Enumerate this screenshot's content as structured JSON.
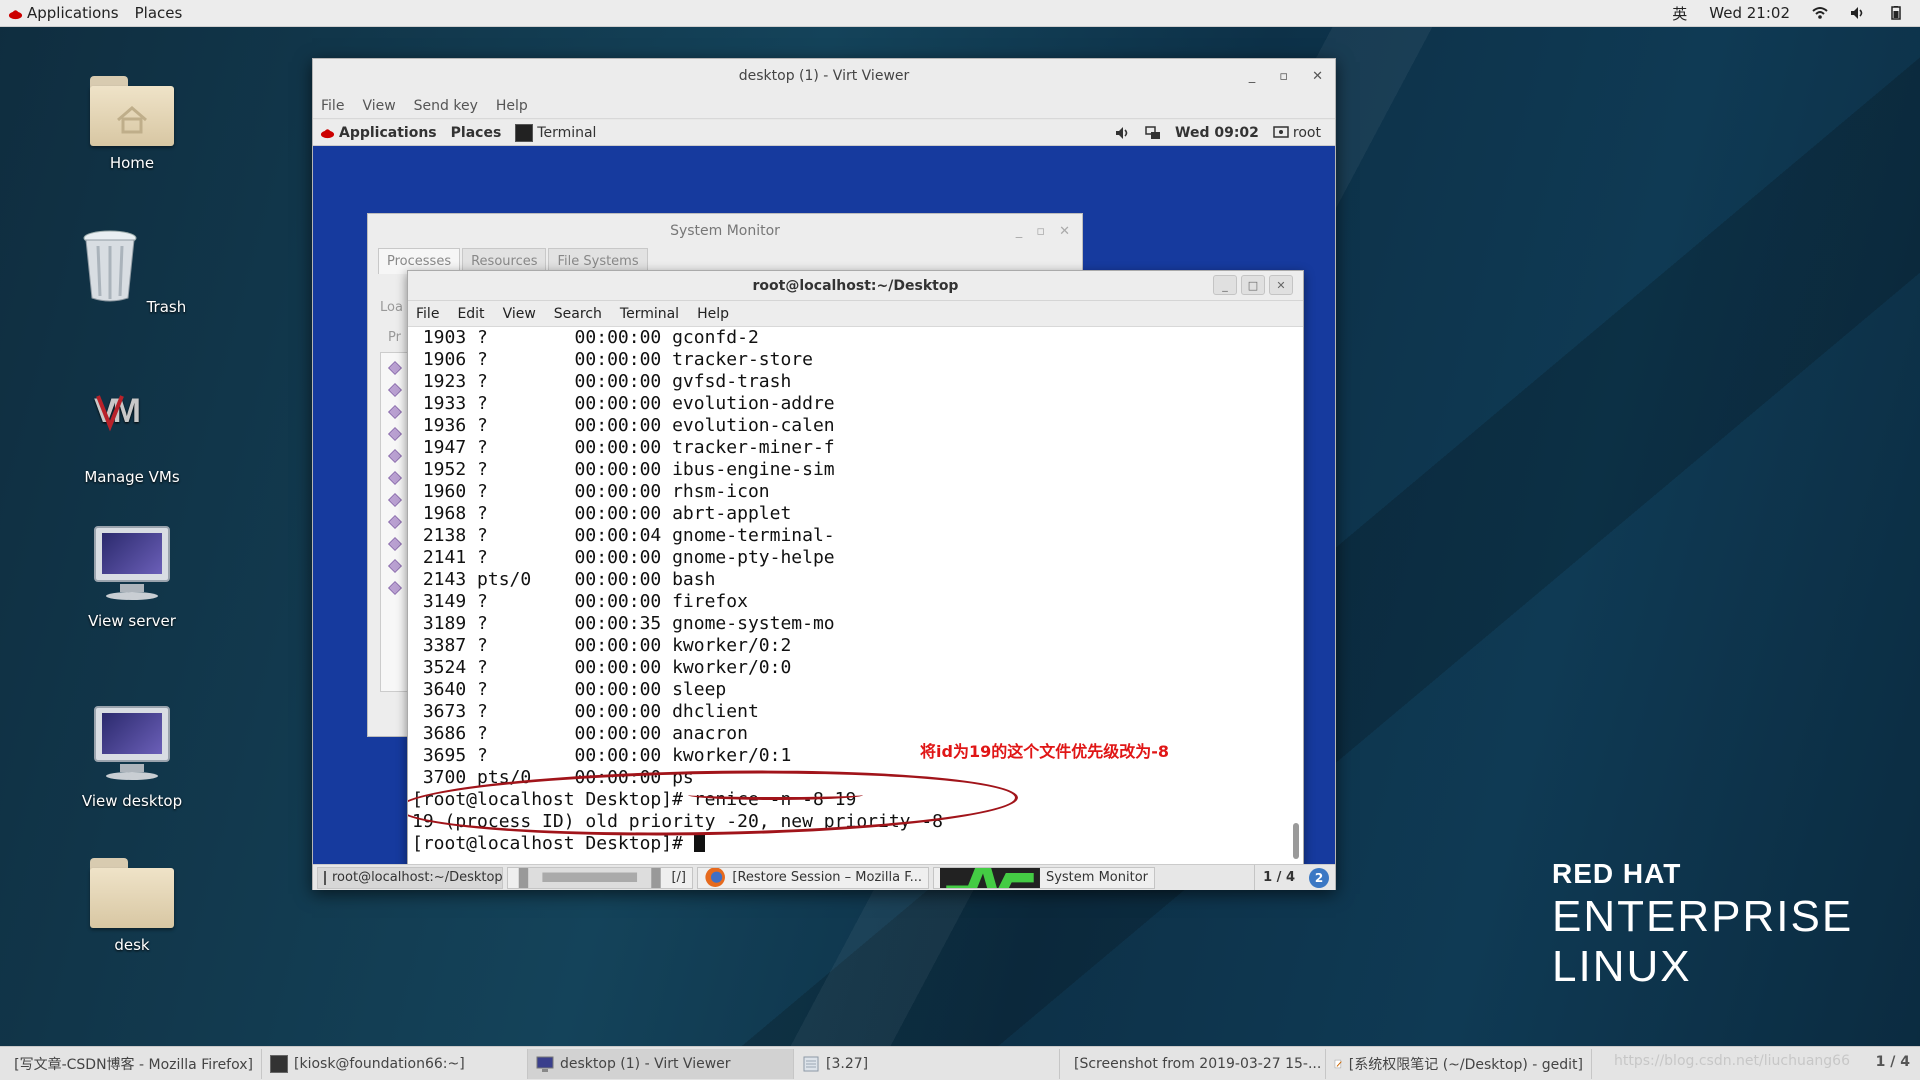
{
  "host_topbar": {
    "applications": "Applications",
    "places": "Places",
    "input_method": "英",
    "clock": "Wed 21:02"
  },
  "desktop_icons": [
    {
      "label": "Home"
    },
    {
      "label": "Trash"
    },
    {
      "label": "Manage VMs"
    },
    {
      "label": "View server"
    },
    {
      "label": "View desktop"
    },
    {
      "label": "desk"
    }
  ],
  "brand": {
    "line1": "RED HAT",
    "line2": "ENTERPRISE",
    "line3": "LINUX"
  },
  "virt_viewer": {
    "title": "desktop (1) - Virt Viewer",
    "menu": [
      "File",
      "View",
      "Send key",
      "Help"
    ]
  },
  "guest_topbar": {
    "applications": "Applications",
    "places": "Places",
    "terminal": "Terminal",
    "clock": "Wed 09:02",
    "user": "root"
  },
  "system_monitor": {
    "title": "System Monitor",
    "tabs": [
      "Processes",
      "Resources",
      "File Systems"
    ],
    "load_prefix": "Loa",
    "list_prefix": "Pr"
  },
  "terminal": {
    "title": "root@localhost:~/Desktop",
    "menu": [
      "File",
      "Edit",
      "View",
      "Search",
      "Terminal",
      "Help"
    ],
    "lines": [
      " 1903 ?        00:00:00 gconfd-2",
      " 1906 ?        00:00:00 tracker-store",
      " 1923 ?        00:00:00 gvfsd-trash",
      " 1933 ?        00:00:00 evolution-addre",
      " 1936 ?        00:00:00 evolution-calen",
      " 1947 ?        00:00:00 tracker-miner-f",
      " 1952 ?        00:00:00 ibus-engine-sim",
      " 1960 ?        00:00:00 rhsm-icon",
      " 1968 ?        00:00:00 abrt-applet",
      " 2138 ?        00:00:04 gnome-terminal-",
      " 2141 ?        00:00:00 gnome-pty-helpe",
      " 2143 pts/0    00:00:00 bash",
      " 3149 ?        00:00:00 firefox",
      " 3189 ?        00:00:35 gnome-system-mo",
      " 3387 ?        00:00:00 kworker/0:2",
      " 3524 ?        00:00:00 kworker/0:0",
      " 3640 ?        00:00:00 sleep",
      " 3673 ?        00:00:00 dhclient",
      " 3686 ?        00:00:00 anacron",
      " 3695 ?        00:00:00 kworker/0:1",
      " 3700 pts/0    00:00:00 ps",
      "[root@localhost Desktop]# renice -n -8 19",
      "19 (process ID) old priority -20, new priority -8",
      "[root@localhost Desktop]# "
    ],
    "annotation": "将id为19的这个文件优先级改为-8"
  },
  "guest_taskbar": {
    "items": [
      "root@localhost:~/Desktop",
      "[/]",
      "[Restore Session – Mozilla F...",
      "System Monitor"
    ],
    "pager": "1 / 4",
    "badge": "2"
  },
  "host_taskbar": {
    "items": [
      "[写文章-CSDN博客 - Mozilla Firefox]",
      "[kiosk@foundation66:~]",
      "desktop (1) - Virt Viewer",
      "[3.27]",
      "[Screenshot from 2019-03-27 15-...",
      "[系统权限笔记 (~/Desktop) - gedit]"
    ],
    "watermark": "https://blog.csdn.net/liuchuang66",
    "pager": "1 / 4"
  },
  "colors": {
    "annotation_red": "#e01616",
    "ellipse": "#a1141a",
    "guest_bg": "#163a9e"
  }
}
